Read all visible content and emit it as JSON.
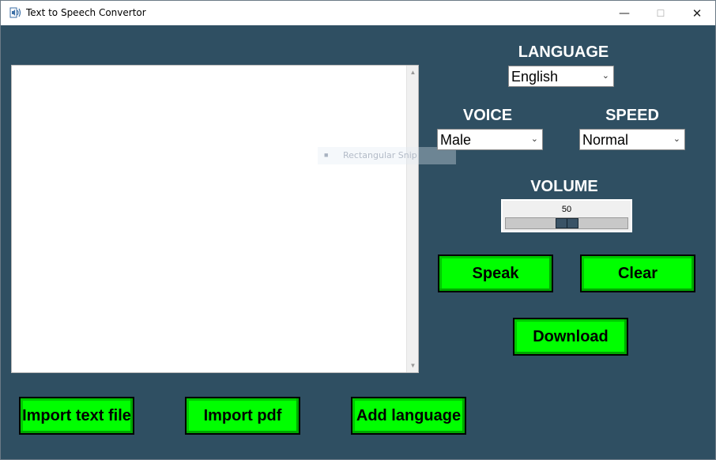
{
  "window": {
    "title": "Text to Speech Convertor",
    "controls": {
      "minimize": "—",
      "maximize": "☐",
      "close": "✕"
    }
  },
  "icons": {
    "app": "speaker-icon",
    "snip": "scissors-icon",
    "chevron": "chevron-down-icon"
  },
  "textarea": {
    "value": ""
  },
  "overlay": {
    "snip_text": "Rectangular Snip"
  },
  "language": {
    "label": "LANGUAGE",
    "selected": "English"
  },
  "voice": {
    "label": "VOICE",
    "selected": "Male"
  },
  "speed": {
    "label": "SPEED",
    "selected": "Normal"
  },
  "volume": {
    "label": "VOLUME",
    "value": 50,
    "value_text": "50",
    "min": 0,
    "max": 100
  },
  "buttons": {
    "speak": "Speak",
    "clear": "Clear",
    "download": "Download",
    "import_text": "Import text file",
    "import_pdf": "Import pdf",
    "add_language": "Add language"
  },
  "colors": {
    "background": "#2f4f62",
    "button": "#00ff00",
    "label": "#ffffff"
  }
}
